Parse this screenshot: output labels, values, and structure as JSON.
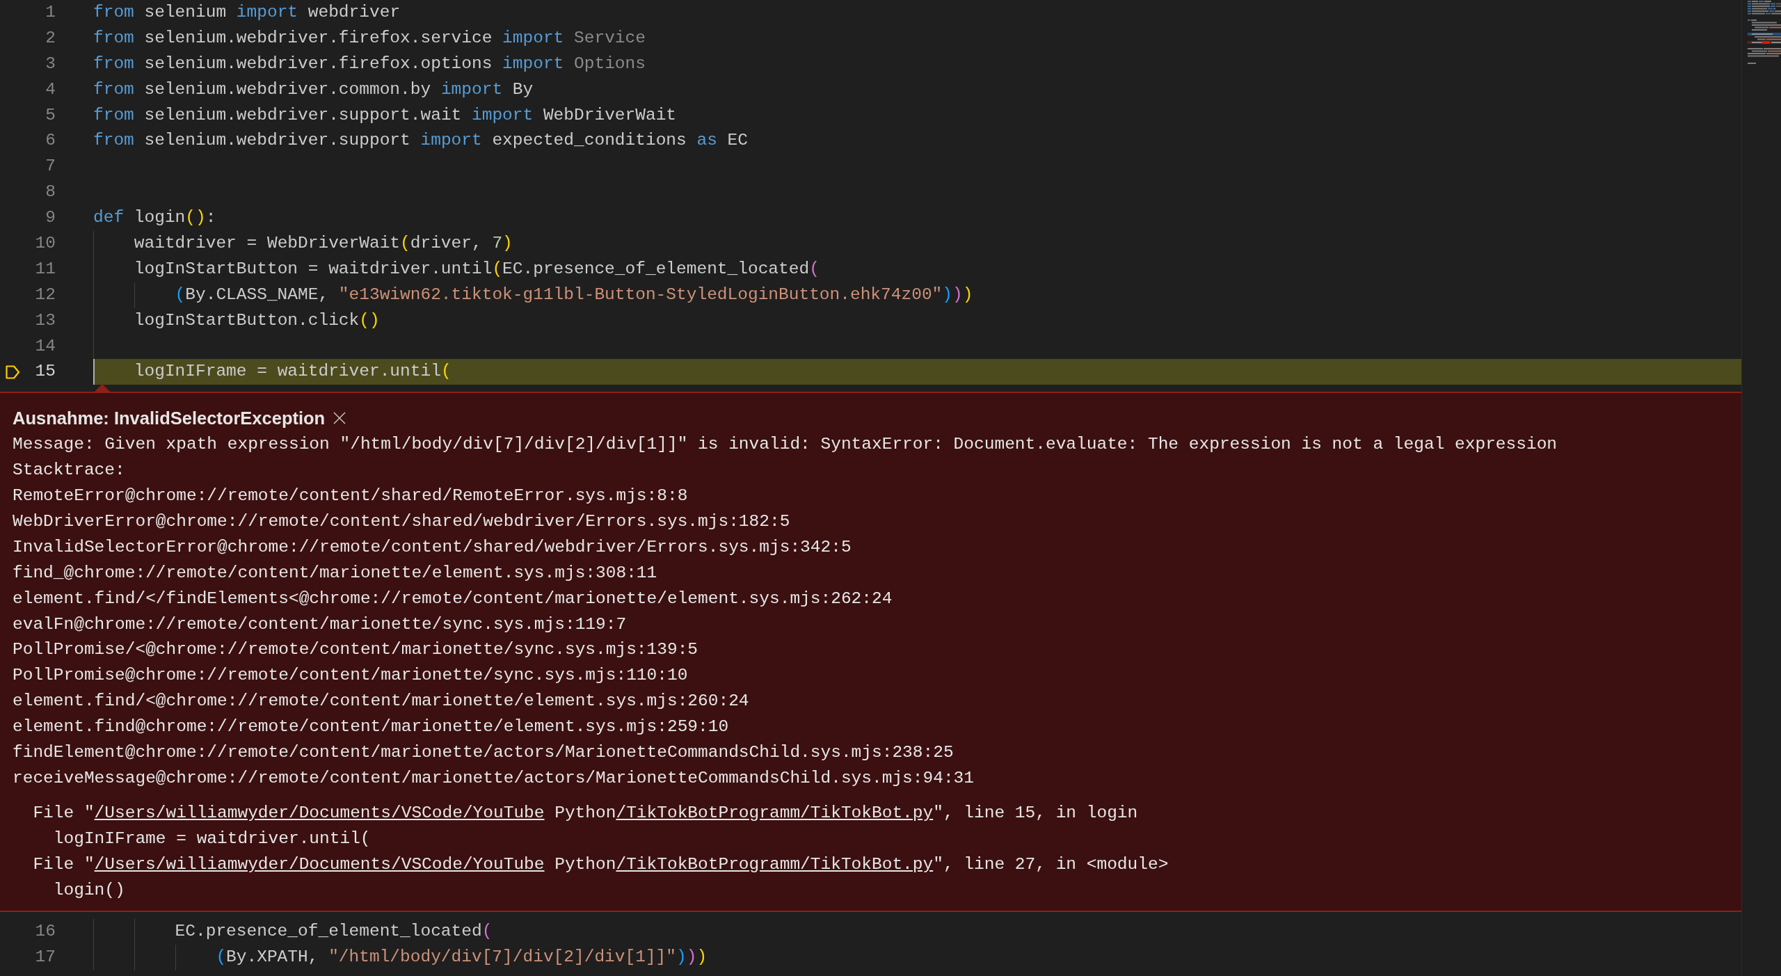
{
  "code_above": {
    "lines": [
      {
        "number": "1",
        "current": false,
        "tokens": [
          {
            "text": "from",
            "kind": "keyword"
          },
          {
            "text": " selenium ",
            "kind": "plain"
          },
          {
            "text": "import",
            "kind": "keyword"
          },
          {
            "text": " webdriver",
            "kind": "plain"
          }
        ]
      },
      {
        "number": "2",
        "current": false,
        "tokens": [
          {
            "text": "from",
            "kind": "keyword"
          },
          {
            "text": " selenium.webdriver.firefox.service ",
            "kind": "plain"
          },
          {
            "text": "import",
            "kind": "keyword"
          },
          {
            "text": " Service",
            "kind": "dim"
          }
        ]
      },
      {
        "number": "3",
        "current": false,
        "tokens": [
          {
            "text": "from",
            "kind": "keyword"
          },
          {
            "text": " selenium.webdriver.firefox.options ",
            "kind": "plain"
          },
          {
            "text": "import",
            "kind": "keyword"
          },
          {
            "text": " Options",
            "kind": "dim"
          }
        ]
      },
      {
        "number": "4",
        "current": false,
        "tokens": [
          {
            "text": "from",
            "kind": "keyword"
          },
          {
            "text": " selenium.webdriver.common.by ",
            "kind": "plain"
          },
          {
            "text": "import",
            "kind": "keyword"
          },
          {
            "text": " By",
            "kind": "plain"
          }
        ]
      },
      {
        "number": "5",
        "current": false,
        "tokens": [
          {
            "text": "from",
            "kind": "keyword"
          },
          {
            "text": " selenium.webdriver.support.wait ",
            "kind": "plain"
          },
          {
            "text": "import",
            "kind": "keyword"
          },
          {
            "text": " WebDriverWait",
            "kind": "plain"
          }
        ]
      },
      {
        "number": "6",
        "current": false,
        "tokens": [
          {
            "text": "from",
            "kind": "keyword"
          },
          {
            "text": " selenium.webdriver.support ",
            "kind": "plain"
          },
          {
            "text": "import",
            "kind": "keyword"
          },
          {
            "text": " expected_conditions ",
            "kind": "plain"
          },
          {
            "text": "as",
            "kind": "keyword"
          },
          {
            "text": " EC",
            "kind": "plain"
          }
        ]
      },
      {
        "number": "7",
        "current": false
      },
      {
        "number": "8",
        "current": false
      },
      {
        "number": "9",
        "current": false,
        "tokens": [
          {
            "text": "def",
            "kind": "keyword"
          },
          {
            "text": " login",
            "kind": "plain"
          },
          {
            "text": "()",
            "kind": "bracket1"
          },
          {
            "text": ":",
            "kind": "plain"
          }
        ]
      },
      {
        "number": "10",
        "current": false,
        "tokens": [
          {
            "text": "    waitdriver = WebDriverWait",
            "kind": "plain"
          },
          {
            "text": "(",
            "kind": "bracket1"
          },
          {
            "text": "driver, ",
            "kind": "plain"
          },
          {
            "text": "7",
            "kind": "number"
          },
          {
            "text": ")",
            "kind": "bracket1"
          }
        ]
      },
      {
        "number": "11",
        "current": false,
        "tokens": [
          {
            "text": "    logInStartButton = waitdriver.until",
            "kind": "plain"
          },
          {
            "text": "(",
            "kind": "bracket1"
          },
          {
            "text": "EC.presence_of_element_located",
            "kind": "plain"
          },
          {
            "text": "(",
            "kind": "bracket2"
          }
        ]
      },
      {
        "number": "12",
        "current": false,
        "tokens": [
          {
            "text": "        (",
            "kind": "bracket3"
          },
          {
            "text": "By.CLASS_NAME, ",
            "kind": "plain"
          },
          {
            "text": "\"e13wiwn62.tiktok-g11lbl-Button-StyledLoginButton.ehk74z00\"",
            "kind": "string"
          },
          {
            "text": ")",
            "kind": "bracket3"
          },
          {
            "text": ")",
            "kind": "bracket2"
          },
          {
            "text": ")",
            "kind": "bracket1"
          }
        ]
      },
      {
        "number": "13",
        "current": false,
        "tokens": [
          {
            "text": "    logInStartButton.click",
            "kind": "plain"
          },
          {
            "text": "()",
            "kind": "bracket1"
          }
        ]
      },
      {
        "number": "14",
        "current": false
      },
      {
        "number": "15",
        "current": true,
        "tokens": [
          {
            "text": "    logInIFrame = waitdriver.until",
            "kind": "plain"
          },
          {
            "text": "(",
            "kind": "bracket1"
          }
        ]
      }
    ]
  },
  "exception": {
    "title": "Ausnahme: InvalidSelectorException",
    "output_lines": [
      "Message: Given xpath expression \"/html/body/div[7]/div[2]/div[1]]\" is invalid: SyntaxError: Document.evaluate: The expression is not a legal expression",
      "Stacktrace:",
      "RemoteError@chrome://remote/content/shared/RemoteError.sys.mjs:8:8",
      "WebDriverError@chrome://remote/content/shared/webdriver/Errors.sys.mjs:182:5",
      "InvalidSelectorError@chrome://remote/content/shared/webdriver/Errors.sys.mjs:342:5",
      "find_@chrome://remote/content/marionette/element.sys.mjs:308:11",
      "element.find/</findElements<@chrome://remote/content/marionette/element.sys.mjs:262:24",
      "evalFn@chrome://remote/content/marionette/sync.sys.mjs:119:7",
      "PollPromise/<@chrome://remote/content/marionette/sync.sys.mjs:139:5",
      "PollPromise@chrome://remote/content/marionette/sync.sys.mjs:110:10",
      "element.find/<@chrome://remote/content/marionette/element.sys.mjs:260:24",
      "element.find@chrome://remote/content/marionette/element.sys.mjs:259:10",
      "findElement@chrome://remote/content/marionette/actors/MarionetteCommandsChild.sys.mjs:238:25",
      "receiveMessage@chrome://remote/content/marionette/actors/MarionetteCommandsChild.sys.mjs:94:31"
    ],
    "traceback": [
      {
        "parts": [
          {
            "text": "File \"",
            "link": false
          },
          {
            "text": "/Users/williamwyder/Documents/VSCode/YouTube",
            "link": true
          },
          {
            "text": " Python",
            "link": false
          },
          {
            "text": "/TikTokBotProgramm/TikTokBot.py",
            "link": true
          },
          {
            "text": "\", line 15, in login",
            "link": false
          }
        ],
        "source": "logInIFrame = waitdriver.until("
      },
      {
        "parts": [
          {
            "text": "File \"",
            "link": false
          },
          {
            "text": "/Users/williamwyder/Documents/VSCode/YouTube",
            "link": true
          },
          {
            "text": " Python",
            "link": false
          },
          {
            "text": "/TikTokBotProgramm/TikTokBot.py",
            "link": true
          },
          {
            "text": "\", line 27, in <module>",
            "link": false
          }
        ],
        "source": "login()"
      }
    ]
  },
  "code_below": {
    "lines": [
      {
        "number": "16",
        "current": false,
        "tokens": [
          {
            "text": "        EC.presence_of_element_located",
            "kind": "plain"
          },
          {
            "text": "(",
            "kind": "bracket2"
          }
        ]
      },
      {
        "number": "17",
        "current": false,
        "tokens": [
          {
            "text": "            (",
            "kind": "bracket3"
          },
          {
            "text": "By.XPATH, ",
            "kind": "plain"
          },
          {
            "text": "\"/html/body/div[7]/div[2]/div[1]]\"",
            "kind": "string"
          },
          {
            "text": ")",
            "kind": "bracket3"
          },
          {
            "text": ")",
            "kind": "bracket2"
          },
          {
            "text": ")",
            "kind": "bracket1"
          }
        ]
      }
    ]
  }
}
